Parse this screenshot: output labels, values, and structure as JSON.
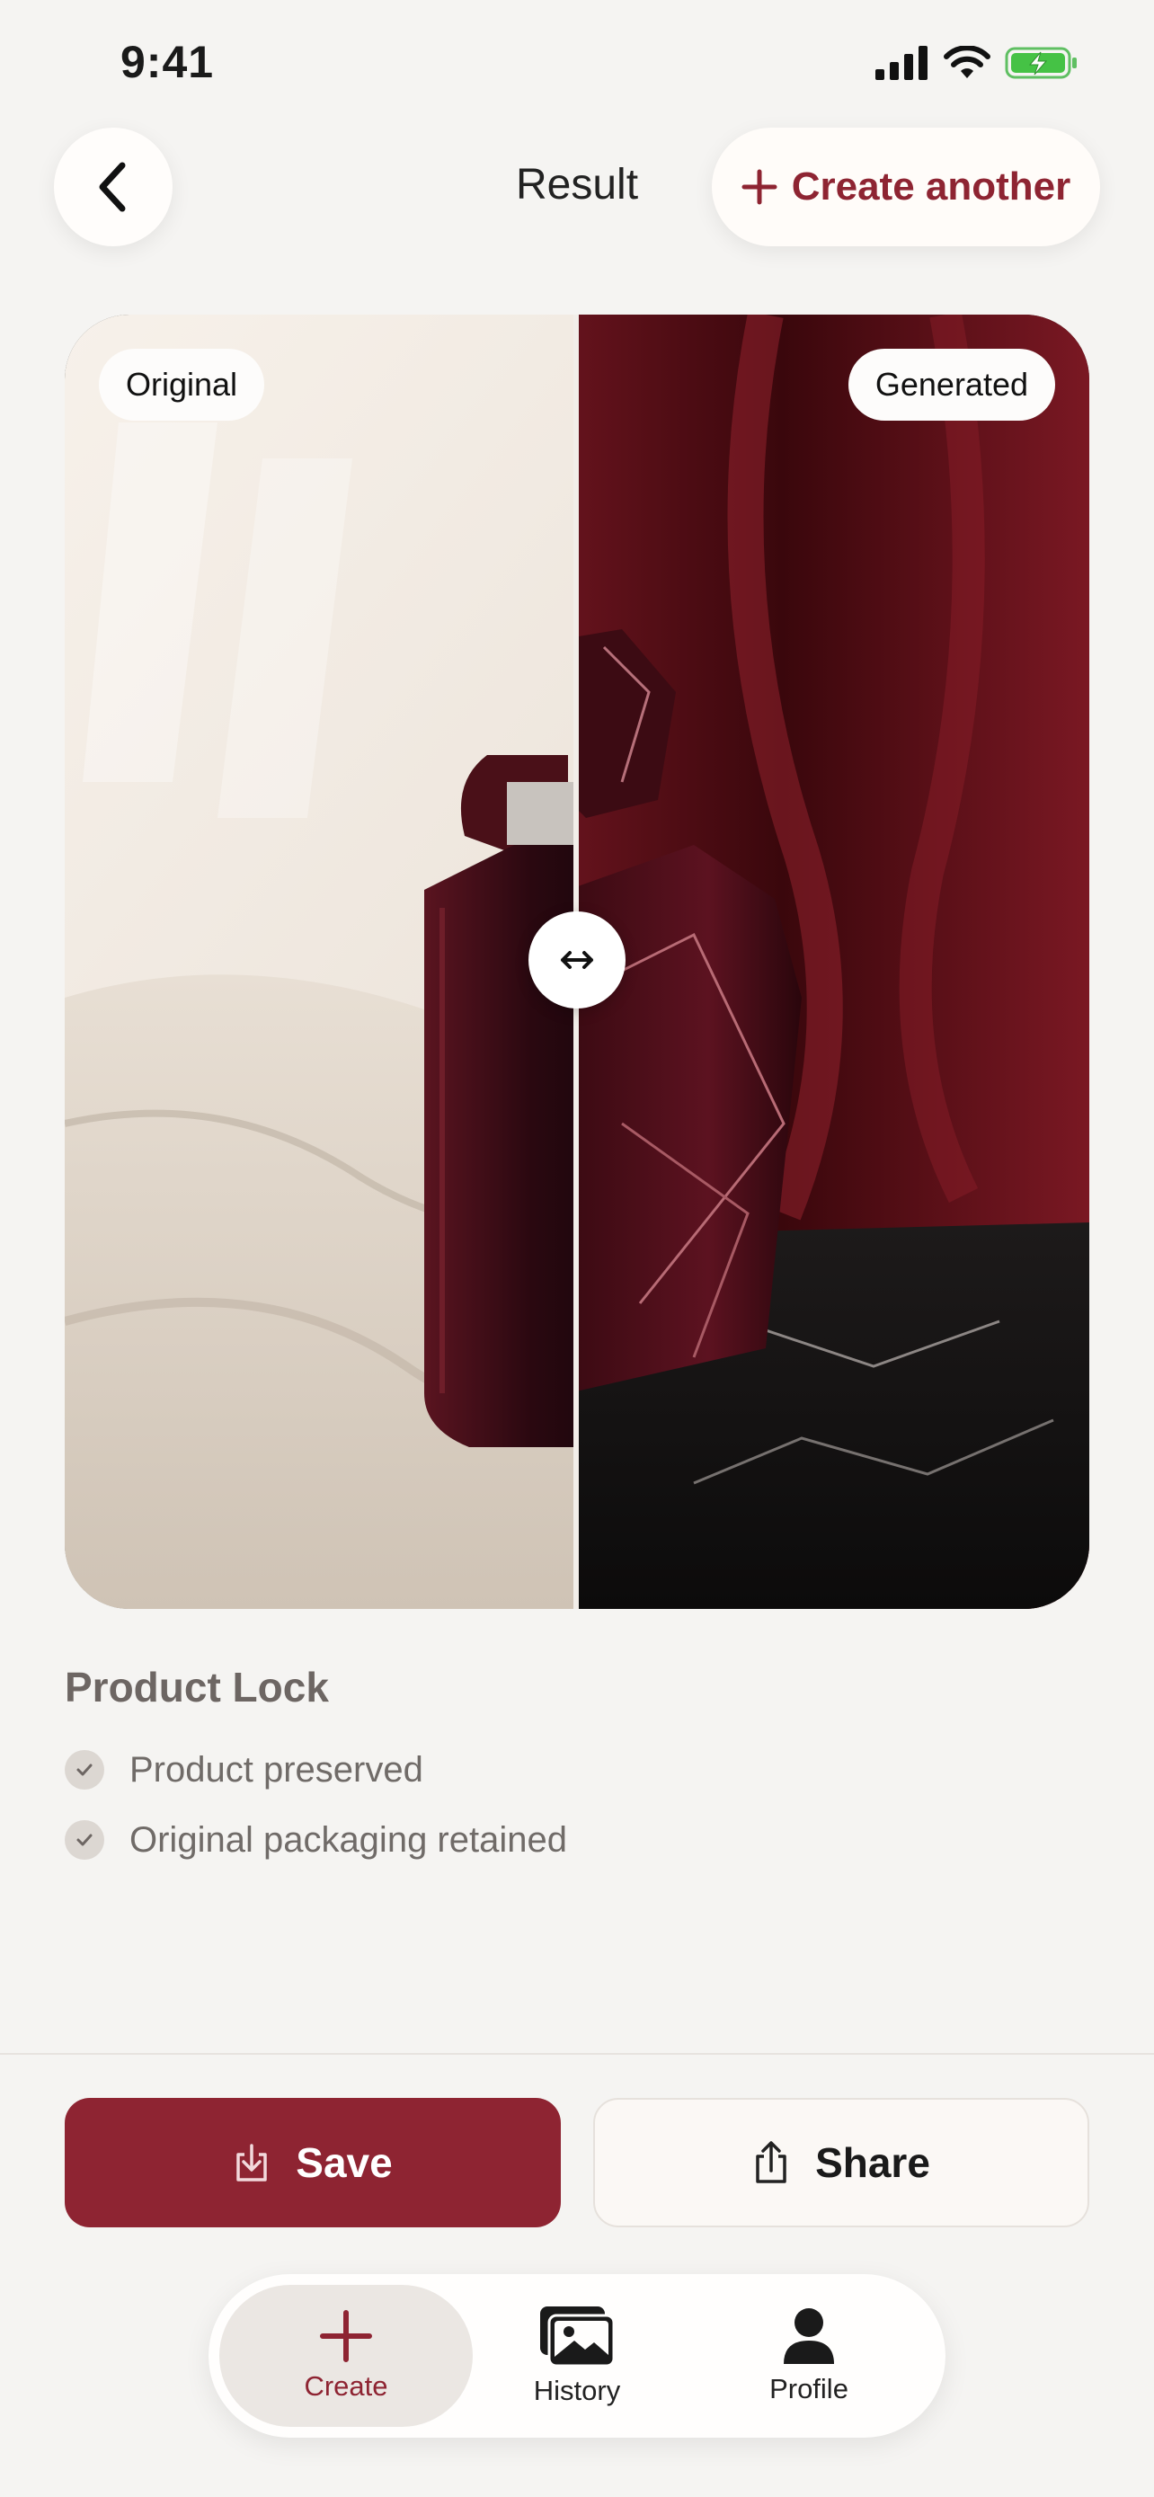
{
  "status_bar": {
    "time": "9:41"
  },
  "header": {
    "title": "Result",
    "create_another_label": "Create another"
  },
  "compare": {
    "original_label": "Original",
    "generated_label": "Generated"
  },
  "product_lock": {
    "title": "Product Lock",
    "items": [
      {
        "label": "Product preserved"
      },
      {
        "label": "Original packaging retained"
      }
    ]
  },
  "actions": {
    "save_label": "Save",
    "share_label": "Share"
  },
  "tab_bar": {
    "tabs": [
      {
        "label": "Create",
        "icon": "plus-icon",
        "active": true
      },
      {
        "label": "History",
        "icon": "gallery-icon",
        "active": false
      },
      {
        "label": "Profile",
        "icon": "person-icon",
        "active": false
      }
    ]
  },
  "colors": {
    "accent": "#8e2432",
    "background": "#f5f4f2",
    "card": "#fffcf9"
  }
}
